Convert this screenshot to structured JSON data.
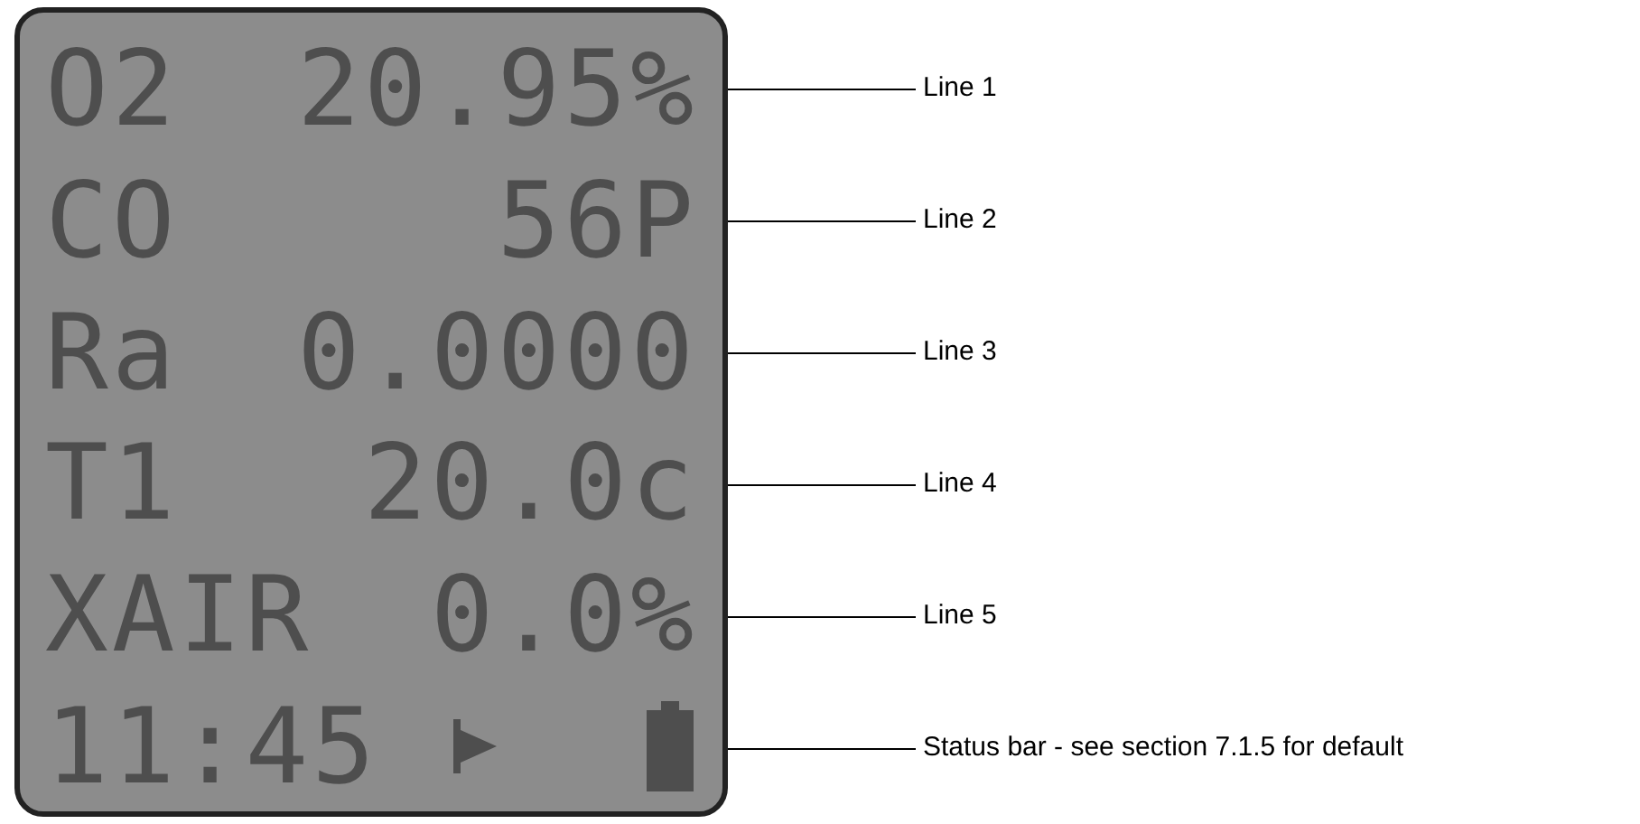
{
  "display": {
    "lines": [
      {
        "label": "O2",
        "value": "20.95%",
        "callout": "Line 1"
      },
      {
        "label": "CO",
        "value": "56P",
        "callout": "Line 2"
      },
      {
        "label": "Ra",
        "value": "0.0000",
        "callout": "Line 3"
      },
      {
        "label": "T1",
        "value": "20.0c",
        "callout": "Line 4"
      },
      {
        "label": "XAIR",
        "value": "0.0%",
        "callout": "Line 5"
      }
    ],
    "status_bar": {
      "time": "11:45",
      "callout": "Status bar - see section 7.1.5 for default"
    }
  }
}
